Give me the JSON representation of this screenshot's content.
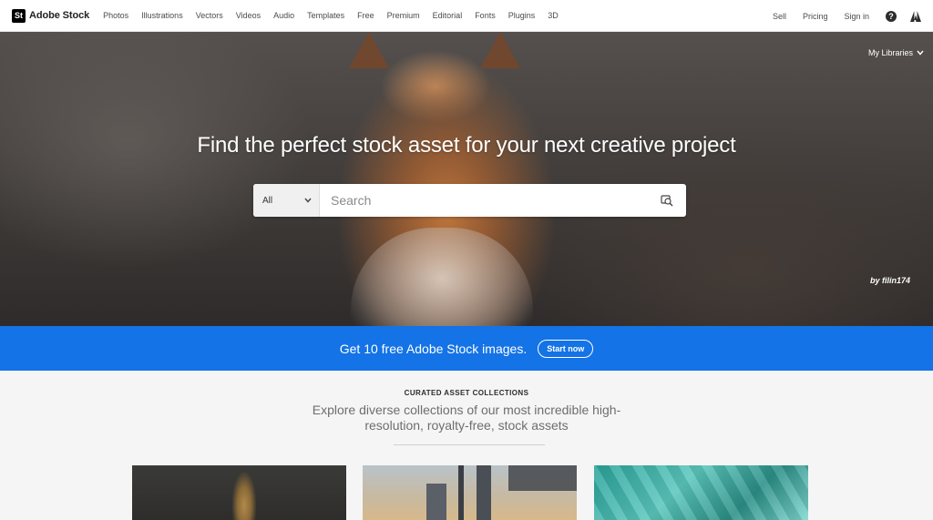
{
  "brand": {
    "badge": "St",
    "name": "Adobe Stock"
  },
  "nav": {
    "links": [
      "Photos",
      "Illustrations",
      "Vectors",
      "Videos",
      "Audio",
      "Templates",
      "Free",
      "Premium",
      "Editorial",
      "Fonts",
      "Plugins",
      "3D"
    ],
    "right": {
      "sell": "Sell",
      "pricing": "Pricing",
      "sign_in": "Sign in",
      "help_glyph": "?"
    }
  },
  "hero": {
    "my_libraries": "My Libraries",
    "title": "Find the perfect stock asset for your next creative project",
    "search": {
      "category": "All",
      "placeholder": "Search"
    },
    "credit": "by filin174"
  },
  "promo": {
    "text": "Get 10 free Adobe Stock images.",
    "button": "Start now",
    "color": "#1473e6"
  },
  "curated": {
    "kicker": "CURATED ASSET COLLECTIONS",
    "desc_line1": "Explore diverse collections of our most incredible high-",
    "desc_line2": "resolution, royalty-free, stock assets"
  },
  "icons": {
    "help": "help-icon",
    "adobe": "adobe-logo-icon",
    "search": "visual-search-icon",
    "chevron": "chevron-down-icon"
  }
}
